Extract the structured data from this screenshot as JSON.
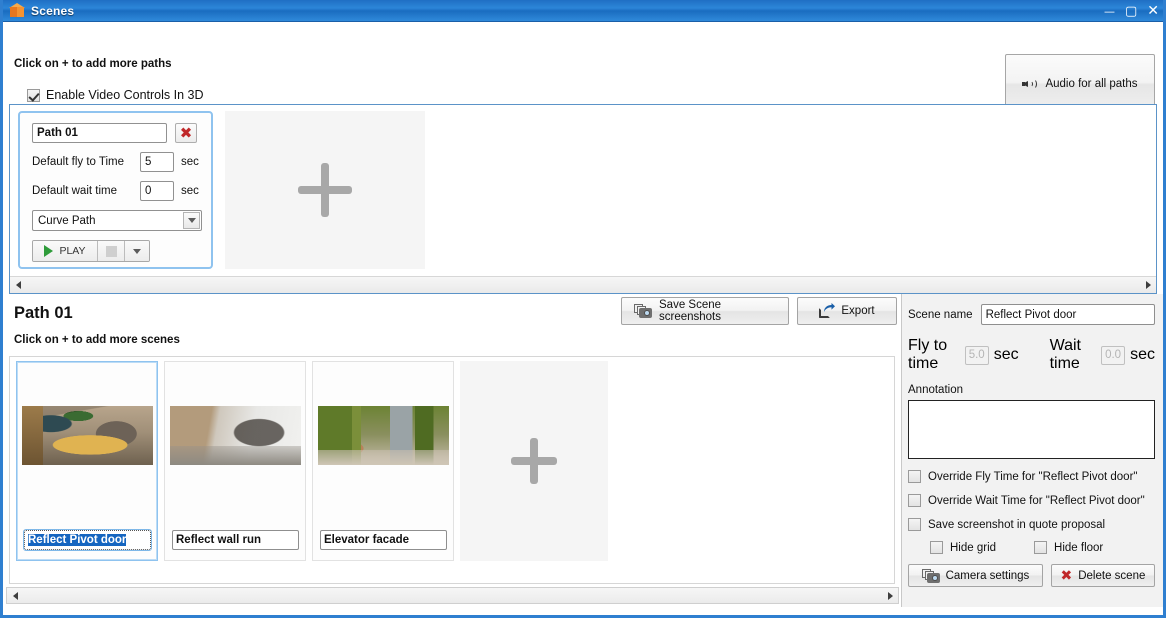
{
  "window": {
    "title": "Scenes",
    "icon": "box-icon",
    "minimize": "—",
    "maximize": "▢",
    "close": "✕"
  },
  "header": {
    "hint": "Click on + to add more paths",
    "enable_video_controls_label": "Enable Video Controls In 3D",
    "enable_video_controls_checked": true,
    "audio_button_label": "Audio for all paths"
  },
  "paths": {
    "card": {
      "name_value": "Path 01",
      "delete_symbol": "✖",
      "fly_to_time_label": "Default fly to Time",
      "fly_to_time_value": "5",
      "fly_to_time_unit": "sec",
      "wait_time_label": "Default wait time",
      "wait_time_value": "0",
      "wait_time_unit": "sec",
      "path_type_value": "Curve Path",
      "play_label": "PLAY"
    },
    "add_tile_symbol": "+"
  },
  "scenes": {
    "path_title": "Path 01",
    "hint": "Click on + to add more scenes",
    "save_screenshots_label": "Save Scene screenshots",
    "export_label": "Export",
    "add_tile_symbol": "+",
    "items": [
      {
        "name": "Reflect Pivot door",
        "selected": true,
        "thumb": "conference-room-thumbnail"
      },
      {
        "name": "Reflect wall run",
        "selected": false,
        "thumb": "wall-run-thumbnail"
      },
      {
        "name": "Elevator facade",
        "selected": false,
        "thumb": "elevator-facade-thumbnail"
      }
    ]
  },
  "scene_settings": {
    "scene_name_label": "Scene name",
    "scene_name_value": "Reflect Pivot door",
    "fly_to_time_label": "Fly to time",
    "fly_to_time_value": "5.0",
    "fly_to_time_unit": "sec",
    "wait_time_label": "Wait time",
    "wait_time_value": "0.0",
    "wait_time_unit": "sec",
    "annotation_label": "Annotation",
    "annotation_value": "",
    "override_fly_label": "Override Fly Time for \"Reflect Pivot door\"",
    "override_wait_label": "Override Wait Time for \"Reflect Pivot door\"",
    "save_screenshot_label": "Save screenshot in quote proposal",
    "hide_grid_label": "Hide grid",
    "hide_floor_label": "Hide floor",
    "camera_settings_label": "Camera settings",
    "delete_scene_label": "Delete scene",
    "delete_symbol": "✖"
  },
  "colors": {
    "titlebar_blue": "#2c86d8",
    "selection_blue": "#1565c0",
    "accent_border": "#8fc3ef",
    "delete_red": "#c0282a",
    "play_green": "#2e9b3a"
  }
}
